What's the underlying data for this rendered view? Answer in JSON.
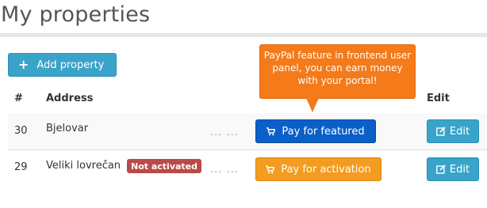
{
  "page": {
    "title": "My properties"
  },
  "toolbar": {
    "add_label": "Add property",
    "add_icon": "plus-icon"
  },
  "table": {
    "headers": {
      "number": "#",
      "address": "Address",
      "edit": "Edit"
    },
    "rows": [
      {
        "id": "30",
        "address": "Bjelovar",
        "badge": "",
        "dots": "... ...",
        "pay_label": "Pay for featured",
        "edit_label": "Edit"
      },
      {
        "id": "29",
        "address": "Veliki lovrečan",
        "badge": "Not activated",
        "dots": "... ...",
        "pay_label": "Pay for activation",
        "edit_label": "Edit"
      }
    ]
  },
  "tooltip": {
    "text": "PayPal feature in frontend user panel, you can earn money with your portal!"
  },
  "colors": {
    "accent_blue": "#3aa3c9",
    "featured_blue": "#0a5fc8",
    "activation_orange": "#f39c1f",
    "tooltip_orange": "#f47a1a",
    "badge_red": "#b94a48"
  }
}
